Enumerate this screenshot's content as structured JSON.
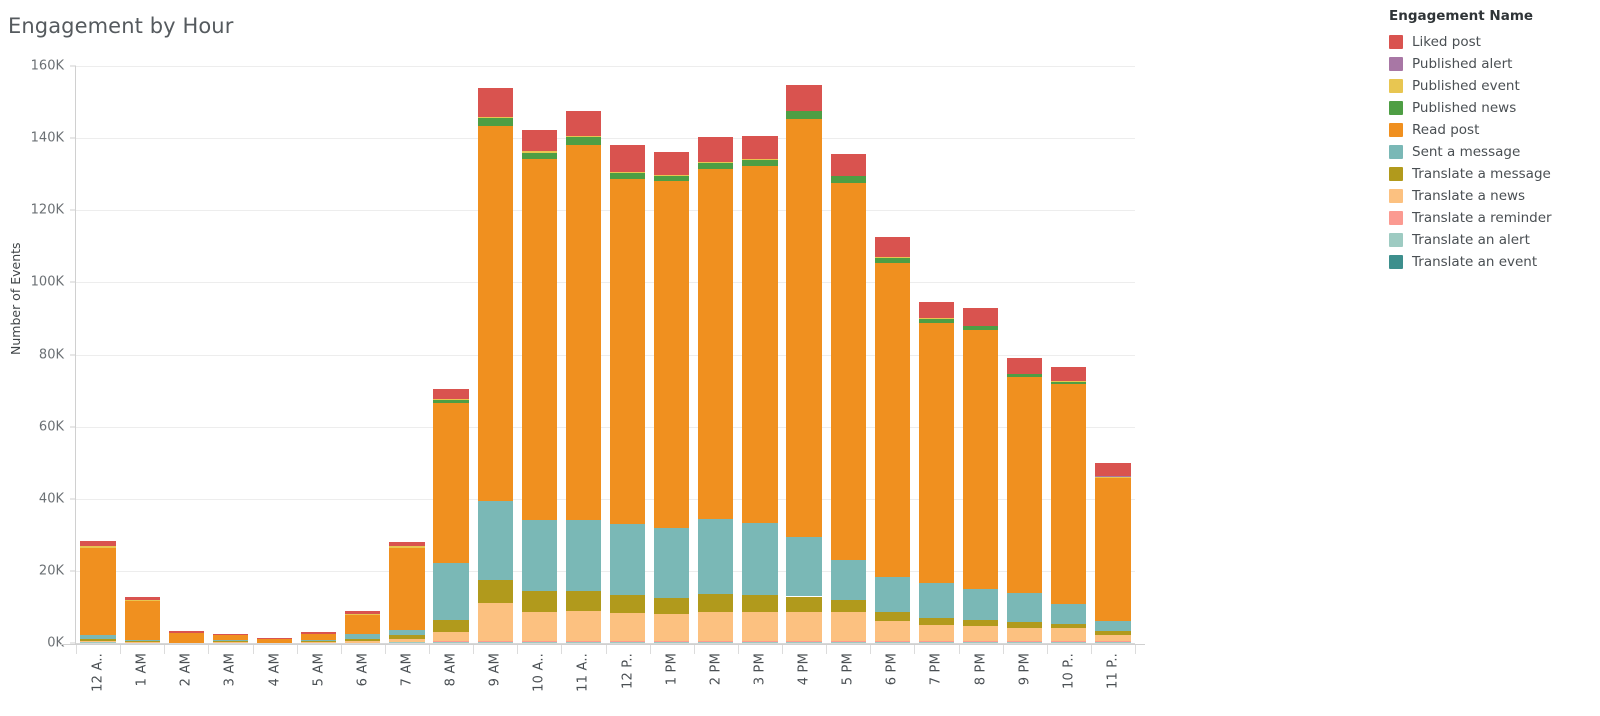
{
  "title": "Engagement by Hour",
  "legend": {
    "title": "Engagement Name",
    "items": [
      {
        "label": "Liked post",
        "color": "#d9534f"
      },
      {
        "label": "Published alert",
        "color": "#a877a5"
      },
      {
        "label": "Published event",
        "color": "#e8c651"
      },
      {
        "label": "Published news",
        "color": "#4e9e44"
      },
      {
        "label": "Read post",
        "color": "#f0901f"
      },
      {
        "label": "Sent a message",
        "color": "#7ab8b6"
      },
      {
        "label": "Translate a message",
        "color": "#b19a1c"
      },
      {
        "label": "Translate a news",
        "color": "#fcc180"
      },
      {
        "label": "Translate a reminder",
        "color": "#fb9a91"
      },
      {
        "label": "Translate an alert",
        "color": "#9ecbc2"
      },
      {
        "label": "Translate an event",
        "color": "#3d8f8d"
      }
    ]
  },
  "axes": {
    "ylabel": "Number of Events",
    "yticks": [
      "0K",
      "20K",
      "40K",
      "60K",
      "80K",
      "100K",
      "120K",
      "140K",
      "160K"
    ],
    "xlabels": [
      "12 A..",
      "1 AM",
      "2 AM",
      "3 AM",
      "4 AM",
      "5 AM",
      "6 AM",
      "7 AM",
      "8 AM",
      "9 AM",
      "10 A..",
      "11 A..",
      "12 P..",
      "1 PM",
      "2 PM",
      "3 PM",
      "4 PM",
      "5 PM",
      "6 PM",
      "7 PM",
      "8 PM",
      "9 PM",
      "10 P..",
      "11 P.."
    ]
  },
  "chart_data": {
    "type": "bar",
    "stacked": true,
    "title": "Engagement by Hour",
    "xlabel": "",
    "ylabel": "Number of Events",
    "ylim": [
      0,
      160000
    ],
    "ytick_values": [
      0,
      20000,
      40000,
      60000,
      80000,
      100000,
      120000,
      140000,
      160000
    ],
    "grid": true,
    "legend_position": "right",
    "legend_title": "Engagement Name",
    "categories": [
      "12 AM",
      "1 AM",
      "2 AM",
      "3 AM",
      "4 AM",
      "5 AM",
      "6 AM",
      "7 AM",
      "8 AM",
      "9 AM",
      "10 AM",
      "11 AM",
      "12 PM",
      "1 PM",
      "2 PM",
      "3 PM",
      "4 PM",
      "5 PM",
      "6 PM",
      "7 PM",
      "8 PM",
      "9 PM",
      "10 PM",
      "11 PM"
    ],
    "stack_order_bottom_to_top": [
      "Translate an event",
      "Translate an alert",
      "Translate a reminder",
      "Translate a news",
      "Translate a message",
      "Sent a message",
      "Read post",
      "Published news",
      "Published event",
      "Published alert",
      "Liked post"
    ],
    "series": [
      {
        "name": "Translate an event",
        "color": "#3d8f8d",
        "values": [
          0,
          0,
          0,
          0,
          0,
          0,
          0,
          0,
          0,
          0,
          0,
          0,
          0,
          0,
          0,
          0,
          0,
          0,
          0,
          0,
          0,
          0,
          0,
          0
        ]
      },
      {
        "name": "Translate an alert",
        "color": "#9ecbc2",
        "values": [
          200,
          0,
          0,
          0,
          0,
          0,
          100,
          300,
          200,
          200,
          200,
          200,
          200,
          200,
          200,
          200,
          200,
          200,
          200,
          200,
          200,
          200,
          200,
          200
        ]
      },
      {
        "name": "Translate a reminder",
        "color": "#fb9a91",
        "values": [
          0,
          0,
          0,
          0,
          0,
          0,
          0,
          0,
          300,
          400,
          300,
          300,
          300,
          300,
          300,
          300,
          300,
          300,
          300,
          300,
          300,
          300,
          300,
          300
        ]
      },
      {
        "name": "Translate a news",
        "color": "#fcc180",
        "values": [
          300,
          200,
          0,
          300,
          0,
          200,
          400,
          700,
          2500,
          10500,
          8200,
          8400,
          7800,
          7600,
          8000,
          8000,
          8200,
          8000,
          5500,
          4500,
          4200,
          3800,
          3600,
          1800
        ]
      },
      {
        "name": "Translate a message",
        "color": "#b19a1c",
        "values": [
          700,
          300,
          0,
          200,
          0,
          300,
          600,
          1100,
          3500,
          6400,
          5800,
          5600,
          4900,
          4400,
          5000,
          4900,
          4200,
          3500,
          2700,
          2000,
          1700,
          1400,
          1200,
          900
        ]
      },
      {
        "name": "Sent a message",
        "color": "#7ab8b6",
        "values": [
          900,
          200,
          0,
          200,
          100,
          300,
          1300,
          1500,
          15800,
          22000,
          19500,
          19700,
          19800,
          19300,
          20800,
          19800,
          16600,
          10900,
          9500,
          9600,
          8600,
          8200,
          5600,
          2900
        ]
      },
      {
        "name": "Read post",
        "color": "#f0901f",
        "values": [
          24300,
          10900,
          2900,
          1500,
          900,
          1700,
          5300,
          22800,
          44300,
          103800,
          100100,
          103800,
          95800,
          96200,
          97100,
          99100,
          115800,
          104700,
          87100,
          72100,
          71900,
          59800,
          60800,
          39700
        ]
      },
      {
        "name": "Published news",
        "color": "#4e9e44",
        "values": [
          0,
          0,
          0,
          0,
          0,
          0,
          0,
          0,
          900,
          2200,
          1900,
          2200,
          1600,
          1600,
          1700,
          1700,
          2100,
          1800,
          1600,
          1100,
          900,
          800,
          700,
          0
        ]
      },
      {
        "name": "Published event",
        "color": "#e8c651",
        "values": [
          400,
          200,
          0,
          0,
          0,
          100,
          300,
          400,
          200,
          300,
          300,
          300,
          200,
          200,
          200,
          200,
          200,
          200,
          200,
          200,
          200,
          200,
          200,
          200
        ]
      },
      {
        "name": "Published alert",
        "color": "#a877a5",
        "values": [
          0,
          0,
          0,
          0,
          0,
          0,
          0,
          0,
          0,
          0,
          0,
          0,
          0,
          0,
          0,
          0,
          0,
          0,
          0,
          0,
          0,
          0,
          0,
          300
        ]
      },
      {
        "name": "Liked post",
        "color": "#d9534f",
        "values": [
          1500,
          900,
          500,
          300,
          200,
          400,
          900,
          1300,
          2800,
          8200,
          6000,
          7100,
          7600,
          6400,
          7100,
          6500,
          7100,
          6100,
          5500,
          4700,
          4800,
          4200,
          4000,
          3700
        ]
      }
    ],
    "totals": [
      28300,
      12700,
      3400,
      2500,
      1200,
      3000,
      8900,
      28100,
      70500,
      154000,
      142300,
      147600,
      138200,
      136200,
      140400,
      140700,
      154700,
      135700,
      112600,
      94700,
      92800,
      78900,
      76600,
      49800
    ]
  }
}
